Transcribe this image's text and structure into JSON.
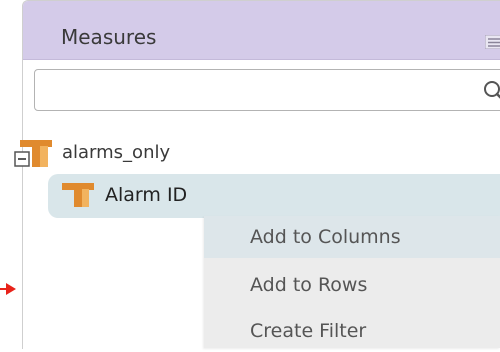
{
  "panel": {
    "title": "Measures",
    "colors": {
      "header_bg": "#d4cbe9",
      "selected_row": "#d9e6ea",
      "menu_bg": "#ececec",
      "menu_highlight": "#dde6ea",
      "icon_orange": "#e08a2e",
      "arrow_red": "#e8231a"
    }
  },
  "search": {
    "value": "",
    "placeholder": "",
    "icon": "search-icon"
  },
  "tree": {
    "root": {
      "label": "alarms_only",
      "icon": "hierarchy-collapse-icon"
    },
    "child": {
      "label": "Alarm ID",
      "icon": "dimension-icon",
      "selected": true
    }
  },
  "context_menu": {
    "items": [
      {
        "label": "Add to Columns",
        "highlighted": true
      },
      {
        "label": "Add to Rows",
        "highlighted": false
      },
      {
        "label": "Create Filter",
        "highlighted": false
      }
    ]
  },
  "pointer": {
    "icon": "red-arrow-icon"
  }
}
